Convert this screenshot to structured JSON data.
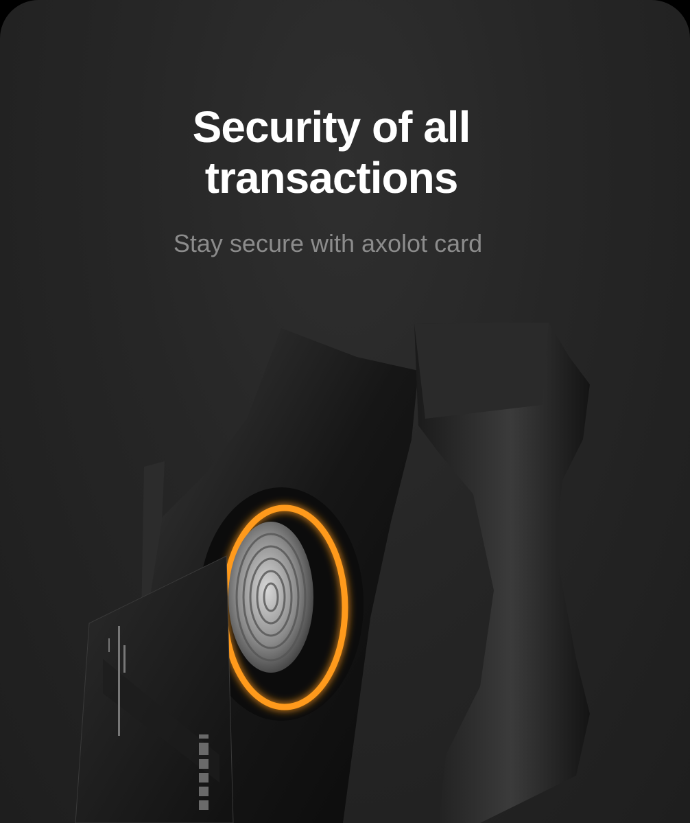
{
  "hero": {
    "title": "Security of all transactions",
    "subtitle": "Stay secure with axolot card"
  },
  "illustration": {
    "device_icon": "fingerprint-scanner-icon",
    "card_brand": "axolot",
    "accent_color": "#ff9a1a"
  },
  "colors": {
    "background": "#262626",
    "title": "#ffffff",
    "subtitle": "#8c8c8c"
  }
}
